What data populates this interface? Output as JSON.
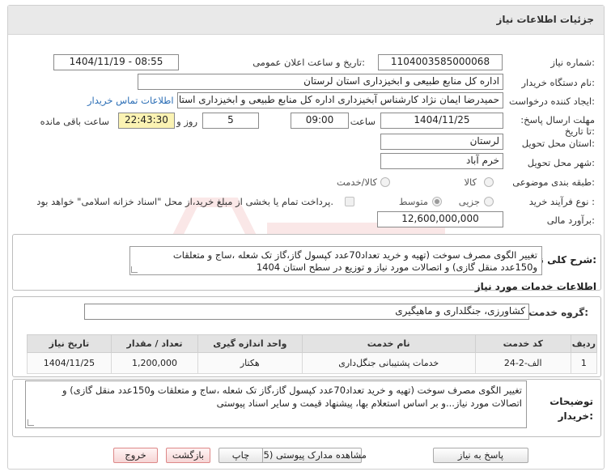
{
  "header": {
    "title": "جزئیات اطلاعات نیاز"
  },
  "fields": {
    "need_number_label": "شماره نیاز:",
    "need_number": "1104003585000068",
    "announce_label": "تاریخ و ساعت اعلان عمومی:",
    "announce_value": "1404/11/19 - 08:55",
    "buyer_org_label": "نام دستگاه خریدار:",
    "buyer_org": "اداره کل منابع طبیعی و ابخیزداری استان لرستان",
    "creator_label": "ایجاد کننده درخواست:",
    "creator": "حمیدرضا ایمان نژاد کارشناس آبخیزداری اداره کل منابع طبیعی و ابخیزداری استان",
    "contact_link": "اطلاعات تماس خریدار",
    "deadline_label": "مهلت ارسال پاسخ: تا تاریخ:",
    "deadline_date": "1404/11/25",
    "time_label": "ساعت",
    "deadline_time": "09:00",
    "days_value": "5",
    "days_label": "روز و",
    "remaining_time": "22:43:30",
    "remaining_label": "ساعت باقی مانده",
    "province_label": "استان محل تحویل:",
    "province": "لرستان",
    "city_label": "شهر محل تحویل:",
    "city": "خرم آباد",
    "category_label": "طبقه بندی موضوعی:",
    "category_options": [
      "کالا",
      "کالا/خدمت"
    ],
    "process_label": "نوع فرآیند خرید :",
    "process_options": [
      "جزیی",
      "متوسط"
    ],
    "payment_note": "پرداخت تمام یا بخشی از مبلغ خرید،از محل \"اسناد خزانه اسلامی\" خواهد بود.",
    "budget_label": "برآورد مالی:",
    "budget": "12,600,000,000"
  },
  "need_summary": {
    "label": "شرح کلی نیاز:",
    "text": "تغییر الگوی مصرف سوخت (تهیه و خرید تعداد70عدد کپسول گاز،گاز تک شعله ،ساج و متعلقات و150عدد منقل گازی)  و اتصالات مورد نیاز و توزیع در سطح استان 1404"
  },
  "services": {
    "section_title": "اطلاعات خدمات مورد نیاز",
    "group_label": "گروه خدمت:",
    "group_value": "کشاورزی، جنگلداری و ماهیگیری",
    "table": {
      "headers": [
        "ردیف",
        "کد خدمت",
        "نام خدمت",
        "واحد اندازه گیری",
        "تعداد / مقدار",
        "تاریخ نیاز"
      ],
      "rows": [
        [
          "1",
          "الف-2-24",
          "خدمات پشتیبانی جنگل‌داری",
          "هکتار",
          "1,200,000",
          "1404/11/25"
        ]
      ]
    }
  },
  "buyer_notes": {
    "label": "توضیحات خریدار:",
    "text": "تغییر الگوی مصرف سوخت (تهیه و خرید تعداد70عدد کپسول گاز،گاز تک شعله ،ساج و متعلقات و150عدد منقل گازی)  و اتصالات مورد نیاز...و بر اساس استعلام بها، پیشنهاد قیمت و سایر اسناد پیوستی"
  },
  "buttons": {
    "reply": "پاسخ به نیاز",
    "attachments": "مشاهده مدارک پیوستی (5)",
    "print": "چاپ",
    "back": "بازگشت",
    "exit": "خروج"
  },
  "colors": {
    "header_bg": "#e9e9e9",
    "link": "#2a6db5",
    "remaining_bg": "#fbf3b3"
  }
}
